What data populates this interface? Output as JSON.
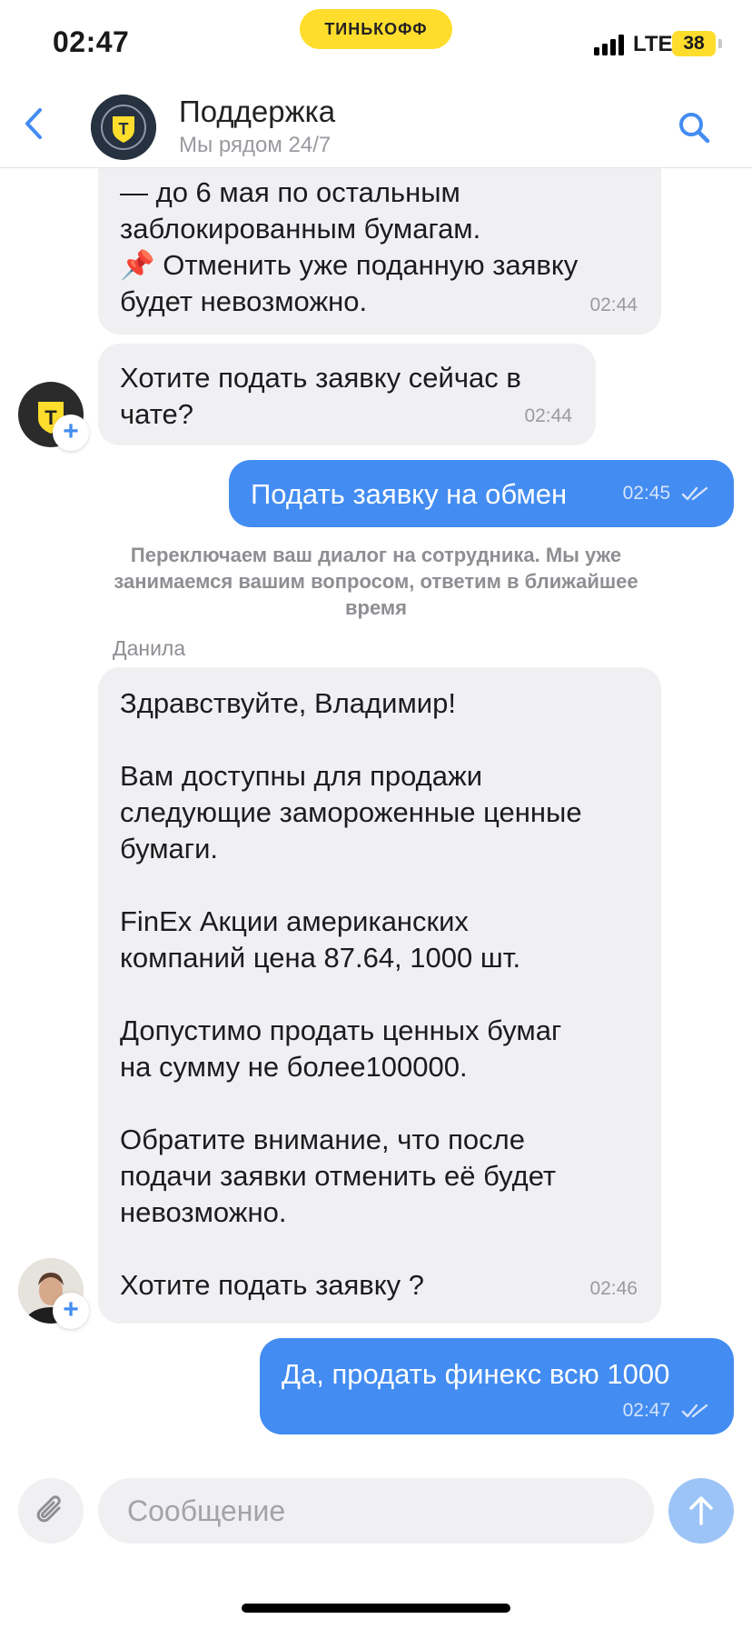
{
  "status_bar": {
    "time": "02:47",
    "brand": "ТИНЬКОФФ",
    "network": "LTE",
    "battery": "38"
  },
  "header": {
    "title": "Поддержка",
    "subtitle": "Мы рядом 24/7",
    "back_icon": "chevron-left-icon",
    "search_icon": "search-icon"
  },
  "messages": [
    {
      "from": "bot",
      "lines": [
        "— до 6 мая по остальным",
        "заблокированным бумагам.",
        "📌 Отменить уже поданную заявку",
        "будет невозможно."
      ],
      "time": "02:44"
    },
    {
      "from": "bot",
      "lines": [
        "Хотите подать заявку сейчас в",
        "чате?"
      ],
      "time": "02:44"
    },
    {
      "from": "me",
      "text": "Подать заявку на обмен",
      "time": "02:45"
    },
    {
      "from": "system",
      "text": "Переключаем ваш диалог на сотрудника. Мы уже занимаемся вашим вопросом, ответим в ближайшее время"
    },
    {
      "from": "agent",
      "sender": "Данила",
      "lines": [
        "Здравствуйте, Владимир!",
        "",
        "Вам доступны для продажи",
        "следующие замороженные ценные",
        "бумаги.",
        "",
        "FinEx Акции американских",
        "компаний цена 87.64, 1000 шт.",
        "",
        "Допустимо продать ценных бумаг",
        "на сумму не более100000.",
        "",
        "Обратите внимание, что после",
        "подачи заявки отменить её будет",
        "невозможно.",
        "",
        "Хотите подать заявку ?"
      ],
      "time": "02:46"
    },
    {
      "from": "me",
      "text": "Да, продать финекс всю 1000",
      "time": "02:47"
    }
  ],
  "composer": {
    "placeholder": "Сообщение",
    "attach_icon": "paperclip-icon",
    "send_icon": "arrow-up-icon"
  },
  "colors": {
    "accent": "#438cf2",
    "bubble_incoming": "#f0f0f2",
    "brand_yellow": "#ffdd2d"
  }
}
